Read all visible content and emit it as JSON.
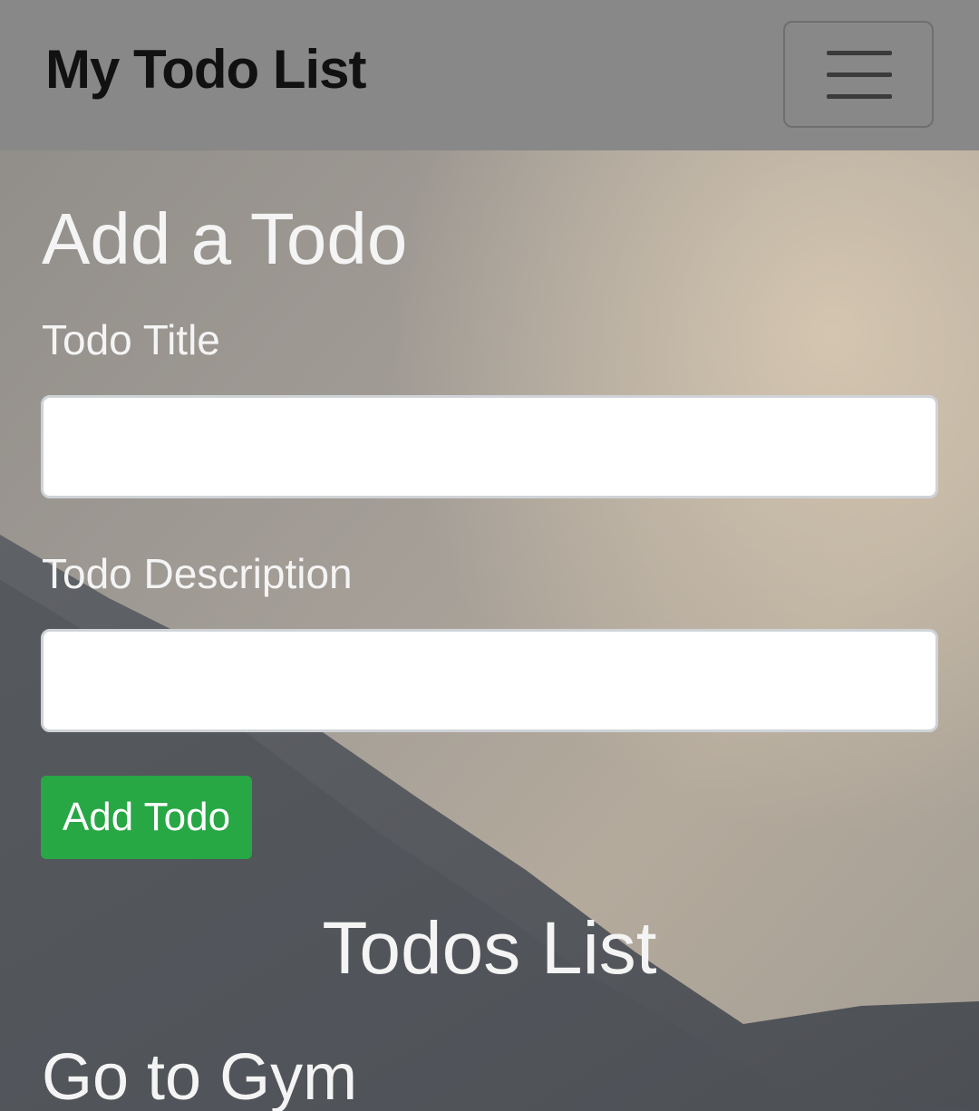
{
  "navbar": {
    "brand": "My Todo List",
    "toggler_icon": "hamburger-menu-icon"
  },
  "form": {
    "heading": "Add a Todo",
    "title_label": "Todo Title",
    "title_value": "",
    "description_label": "Todo Description",
    "description_value": "",
    "submit_label": "Add Todo"
  },
  "list": {
    "heading": "Todos List",
    "items": [
      {
        "title": "Go to Gym"
      }
    ]
  },
  "colors": {
    "navbar_bg": "#888888",
    "button_green": "#28a745",
    "text_light": "#f4f4f4",
    "brand_text": "#111111"
  }
}
